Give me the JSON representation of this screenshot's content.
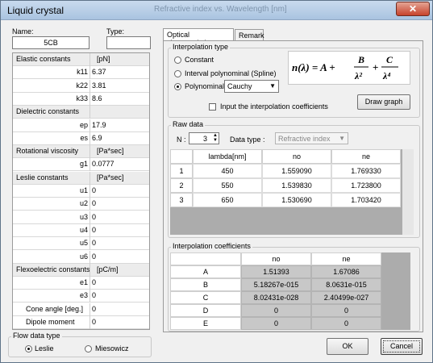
{
  "window": {
    "title": "Liquid crystal",
    "ghost_title": "Refractive index vs. Wavelength [nm]",
    "close_glyph": "✕"
  },
  "name": {
    "label": "Name:",
    "value": "5CB"
  },
  "type": {
    "label": "Type:",
    "value": ""
  },
  "left_table": [
    {
      "kind": "head",
      "key": "Elastic constants",
      "value": "[pN]"
    },
    {
      "kind": "row",
      "key": "k11",
      "value": "6.37"
    },
    {
      "kind": "row",
      "key": "k22",
      "value": "3.81"
    },
    {
      "kind": "row",
      "key": "k33",
      "value": "8.6"
    },
    {
      "kind": "head",
      "key": "Dielectric constants",
      "value": ""
    },
    {
      "kind": "row",
      "key": "ep",
      "value": "17.9"
    },
    {
      "kind": "row",
      "key": "es",
      "value": "6.9"
    },
    {
      "kind": "head",
      "key": "Rotational viscosity",
      "value": "[Pa*sec]"
    },
    {
      "kind": "row",
      "key": "g1",
      "value": "0.0777"
    },
    {
      "kind": "head",
      "key": "Leslie constants",
      "value": "[Pa*sec]"
    },
    {
      "kind": "row",
      "key": "u1",
      "value": "0"
    },
    {
      "kind": "row",
      "key": "u2",
      "value": "0"
    },
    {
      "kind": "row",
      "key": "u3",
      "value": "0"
    },
    {
      "kind": "row",
      "key": "u4",
      "value": "0"
    },
    {
      "kind": "row",
      "key": "u5",
      "value": "0"
    },
    {
      "kind": "row",
      "key": "u6",
      "value": "0"
    },
    {
      "kind": "head",
      "key": "Flexoelectric constants",
      "value": "[pC/m]"
    },
    {
      "kind": "row",
      "key": "e1",
      "value": "0"
    },
    {
      "kind": "row",
      "key": "e3",
      "value": "0"
    },
    {
      "kind": "rowl",
      "key": "Cone angle [deg.]",
      "value": "0"
    },
    {
      "kind": "rowl",
      "key": "Dipole moment",
      "value": "0"
    }
  ],
  "flow": {
    "title": "Flow data type",
    "options": [
      "Leslie",
      "Miesowicz"
    ],
    "selected": "Leslie"
  },
  "tabs": [
    "Optical characteristic",
    "Remark"
  ],
  "interp_type": {
    "title": "Interpolation type",
    "options": [
      "Constant",
      "Interval polynominal (Spline)",
      "Polynominal"
    ],
    "selected": "Polynominal",
    "poly_model": "Cauchy",
    "input_coef_label": "Input the interpolation coefficients",
    "draw_graph": "Draw graph"
  },
  "raw_data": {
    "title": "Raw data",
    "n_label": "N :",
    "n_value": "3",
    "data_type_label": "Data type :",
    "data_type_value": "Refractive index",
    "columns": [
      "lambda[nm]",
      "no",
      "ne"
    ],
    "rows": [
      {
        "index": "1",
        "cells": [
          "450",
          "1.559090",
          "1.769330"
        ]
      },
      {
        "index": "2",
        "cells": [
          "550",
          "1.539830",
          "1.723800"
        ]
      },
      {
        "index": "3",
        "cells": [
          "650",
          "1.530690",
          "1.703420"
        ]
      }
    ]
  },
  "coefficients": {
    "title": "Interpolation coefficients",
    "columns": [
      "no",
      "ne"
    ],
    "rows": [
      {
        "label": "A",
        "cells": [
          "1.51393",
          "1.67086"
        ]
      },
      {
        "label": "B",
        "cells": [
          "5.18267e-015",
          "8.0631e-015"
        ]
      },
      {
        "label": "C",
        "cells": [
          "8.02431e-028",
          "2.40499e-027"
        ]
      },
      {
        "label": "D",
        "cells": [
          "0",
          "0"
        ]
      },
      {
        "label": "E",
        "cells": [
          "0",
          "0"
        ]
      }
    ]
  },
  "buttons": {
    "ok": "OK",
    "cancel": "Cancel"
  }
}
